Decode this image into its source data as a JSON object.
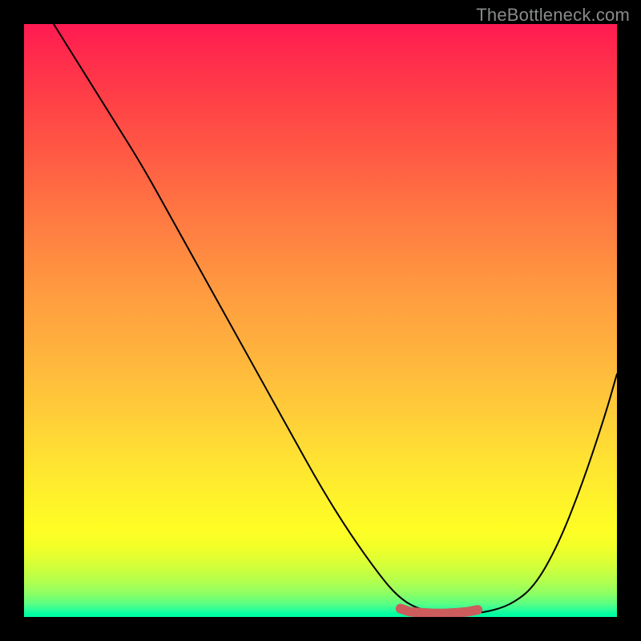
{
  "watermark": "TheBottleneck.com",
  "colors": {
    "gradient_top": "#ff1a52",
    "gradient_mid": "#ffe133",
    "gradient_bottom": "#00ffa2",
    "curve": "#000000",
    "marker": "#cd5c5c",
    "background": "#000000",
    "watermark_text": "#888a8c"
  },
  "chart_data": {
    "type": "line",
    "title": "",
    "xlabel": "",
    "ylabel": "",
    "xlim": [
      0,
      100
    ],
    "ylim": [
      0,
      100
    ],
    "grid": false,
    "legend": false,
    "series": [
      {
        "name": "bottleneck-curve",
        "x": [
          5,
          10,
          15,
          20,
          25,
          30,
          35,
          40,
          45,
          50,
          55,
          60,
          63,
          66,
          70,
          74,
          78,
          82,
          86,
          90,
          94,
          98,
          100
        ],
        "y": [
          100,
          92,
          84,
          76,
          67,
          58,
          49,
          40,
          31,
          22,
          14,
          7,
          3.5,
          1.5,
          0.6,
          0.5,
          0.8,
          2,
          5,
          12,
          22,
          34,
          41
        ],
        "note": "y is a relative bottleneck/penalty metric, 0 = optimal (green), 100 = worst (red); minimum plateau highlighted by marker"
      },
      {
        "name": "optimal-marker",
        "x": [
          63.5,
          65,
          67,
          69,
          71,
          73,
          75,
          76.5
        ],
        "y": [
          1.4,
          0.9,
          0.7,
          0.6,
          0.6,
          0.7,
          0.9,
          1.2
        ]
      }
    ]
  }
}
